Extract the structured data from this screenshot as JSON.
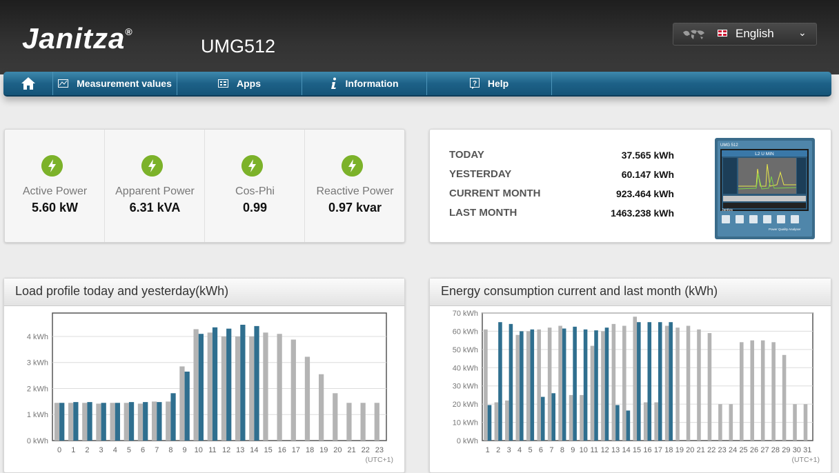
{
  "header": {
    "brand": "Janitza",
    "brand_mark": "®",
    "device": "UMG512",
    "language": "English"
  },
  "nav": {
    "home_icon": "home-icon",
    "items": [
      {
        "label": "Measurement values",
        "icon": "chart-icon"
      },
      {
        "label": "Apps",
        "icon": "apps-icon"
      },
      {
        "label": "Information",
        "icon": "info-icon"
      },
      {
        "label": "Help",
        "icon": "help-icon"
      }
    ]
  },
  "colors": {
    "nav_blue": "#1d6187",
    "bolt_green": "#7cb22a",
    "bar_blue": "#2f6f8f",
    "bar_grey": "#b4b4b4"
  },
  "kpis": [
    {
      "label": "Active Power",
      "value": "5.60 kW",
      "icon": "bolt-icon"
    },
    {
      "label": "Apparent Power",
      "value": "6.31 kVA",
      "icon": "bolt-icon"
    },
    {
      "label": "Cos-Phi",
      "value": "0.99",
      "icon": "bolt-icon"
    },
    {
      "label": "Reactive Power",
      "value": "0.97 kvar",
      "icon": "bolt-icon"
    }
  ],
  "energy": [
    {
      "label": "TODAY",
      "value": "37.565 kWh"
    },
    {
      "label": "YESTERDAY",
      "value": "60.147 kWh"
    },
    {
      "label": "CURRENT MONTH",
      "value": "923.464 kWh"
    },
    {
      "label": "LAST MONTH",
      "value": "1463.238 kWh"
    }
  ],
  "device_screen": {
    "model": "UMG 512",
    "title": "L2 U MIN",
    "caption": "Power Quality Analyser",
    "brand": "Janitza"
  },
  "chart_data": [
    {
      "type": "bar",
      "title": "Load profile today and yesterday(kWh)",
      "x_note": "(UTC+1)",
      "categories": [
        "0",
        "1",
        "2",
        "3",
        "4",
        "5",
        "6",
        "7",
        "8",
        "9",
        "10",
        "11",
        "12",
        "13",
        "14",
        "15",
        "16",
        "17",
        "18",
        "19",
        "20",
        "21",
        "22",
        "23"
      ],
      "y_ticks": [
        "0 kWh",
        "1 kWh",
        "2 kWh",
        "3 kWh",
        "4 kWh"
      ],
      "ylim": [
        0,
        4.9
      ],
      "series": [
        {
          "role": "yesterday",
          "color": "#b4b4b4",
          "values": [
            1.45,
            1.45,
            1.45,
            1.42,
            1.45,
            1.45,
            1.42,
            1.5,
            1.5,
            2.85,
            4.28,
            4.15,
            4.0,
            4.0,
            4.0,
            4.15,
            4.1,
            3.88,
            3.22,
            2.55,
            1.82,
            1.45,
            1.45,
            1.45
          ]
        },
        {
          "role": "today",
          "color": "#2f6f8f",
          "values": [
            1.45,
            1.48,
            1.48,
            1.45,
            1.45,
            1.48,
            1.48,
            1.48,
            1.82,
            2.65,
            4.1,
            4.35,
            4.3,
            4.45,
            4.4,
            null,
            null,
            null,
            null,
            null,
            null,
            null,
            null,
            null
          ]
        }
      ]
    },
    {
      "type": "bar",
      "title": "Energy consumption current and last month (kWh)",
      "x_note": "(UTC+1)",
      "categories": [
        "1",
        "2",
        "3",
        "4",
        "5",
        "6",
        "7",
        "8",
        "9",
        "10",
        "11",
        "12",
        "13",
        "14",
        "15",
        "16",
        "17",
        "18",
        "19",
        "20",
        "21",
        "22",
        "23",
        "24",
        "25",
        "26",
        "27",
        "28",
        "29",
        "30",
        "31"
      ],
      "y_ticks": [
        "0 kWh",
        "10 kWh",
        "20 kWh",
        "30 kWh",
        "40 kWh",
        "50 kWh",
        "60 kWh",
        "70 kWh"
      ],
      "ylim": [
        0,
        70
      ],
      "series": [
        {
          "role": "last month",
          "color": "#b4b4b4",
          "values": [
            61,
            21,
            22,
            58,
            60,
            61,
            62,
            63,
            25,
            25,
            52,
            60,
            64,
            63,
            68,
            21,
            21,
            63,
            62,
            63,
            61,
            59,
            20,
            20,
            54,
            55,
            55,
            54,
            47,
            20,
            20
          ]
        },
        {
          "role": "current month",
          "color": "#2f6f8f",
          "values": [
            19.5,
            65,
            64,
            60,
            61,
            24,
            26,
            61.5,
            62.5,
            61,
            60.5,
            62,
            19.5,
            16.5,
            65,
            65,
            65,
            65,
            null,
            null,
            null,
            null,
            null,
            null,
            null,
            null,
            null,
            null,
            null,
            null,
            null
          ]
        }
      ]
    }
  ]
}
